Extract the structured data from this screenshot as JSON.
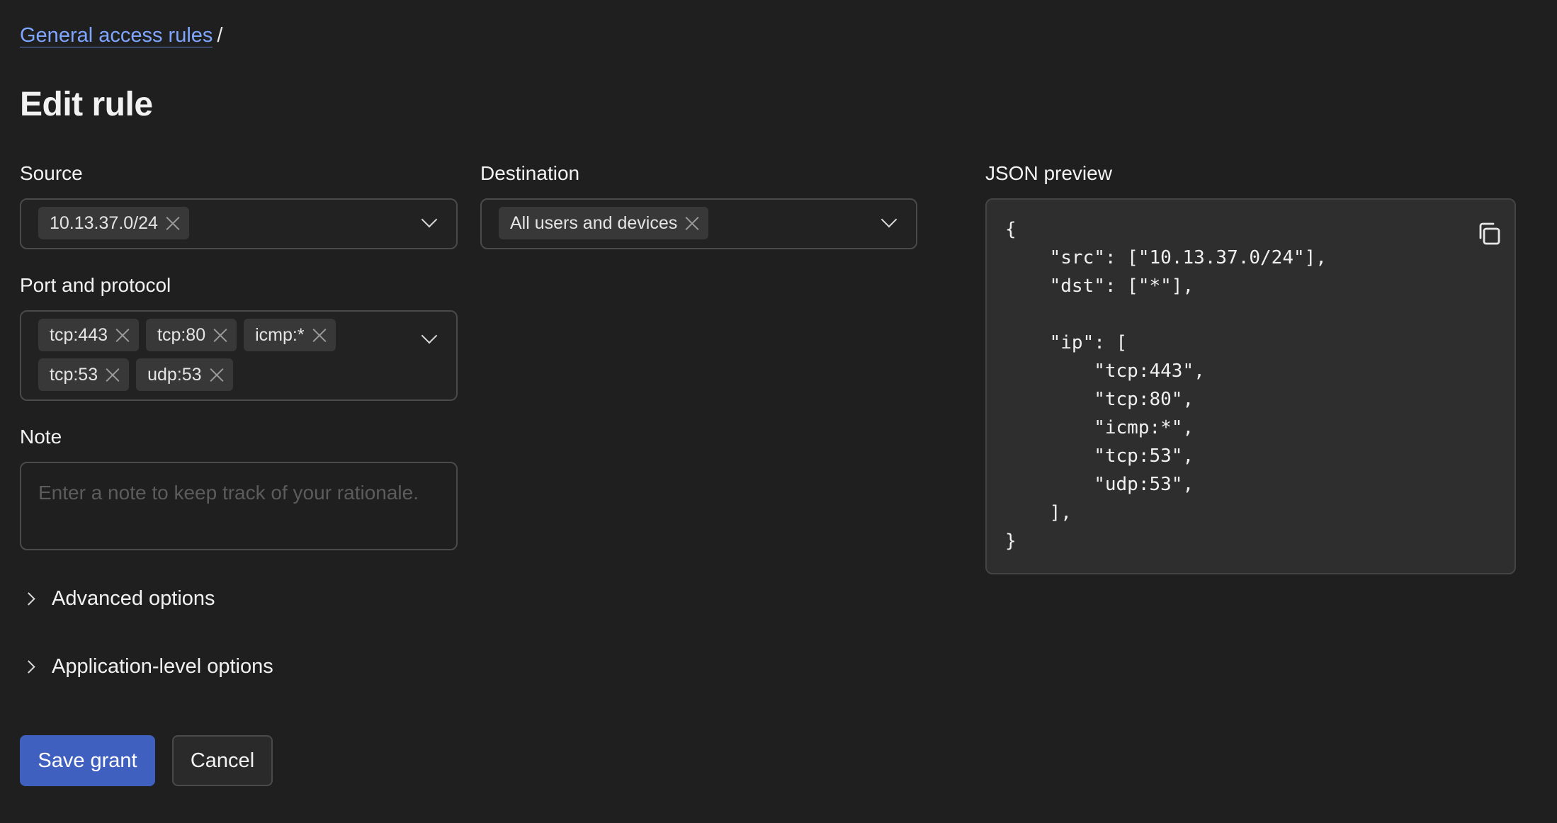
{
  "breadcrumb": {
    "link": "General access rules",
    "separator": "/"
  },
  "page_title": "Edit rule",
  "source": {
    "label": "Source",
    "chips": [
      "10.13.37.0/24"
    ]
  },
  "destination": {
    "label": "Destination",
    "chips": [
      "All users and devices"
    ]
  },
  "ports": {
    "label": "Port and protocol",
    "chips": [
      "tcp:443",
      "tcp:80",
      "icmp:*",
      "tcp:53",
      "udp:53"
    ]
  },
  "note": {
    "label": "Note",
    "placeholder": "Enter a note to keep track of your rationale."
  },
  "disclosures": {
    "advanced": "Advanced options",
    "application": "Application-level options"
  },
  "buttons": {
    "save": "Save grant",
    "cancel": "Cancel"
  },
  "json_preview": {
    "label": "JSON preview",
    "code": "{\n    \"src\": [\"10.13.37.0/24\"],\n    \"dst\": [\"*\"],\n\n    \"ip\": [\n        \"tcp:443\",\n        \"tcp:80\",\n        \"icmp:*\",\n        \"tcp:53\",\n        \"udp:53\",\n    ],\n}"
  },
  "icons": {
    "chip_remove": "x-icon",
    "dropdown": "chevron-down-icon",
    "expand": "chevron-right-icon",
    "copy": "copy-icon"
  },
  "colors": {
    "accent": "#4060c0",
    "link": "#7fa6ff",
    "background": "#1f1f1f",
    "panel": "#2e2e2e"
  }
}
